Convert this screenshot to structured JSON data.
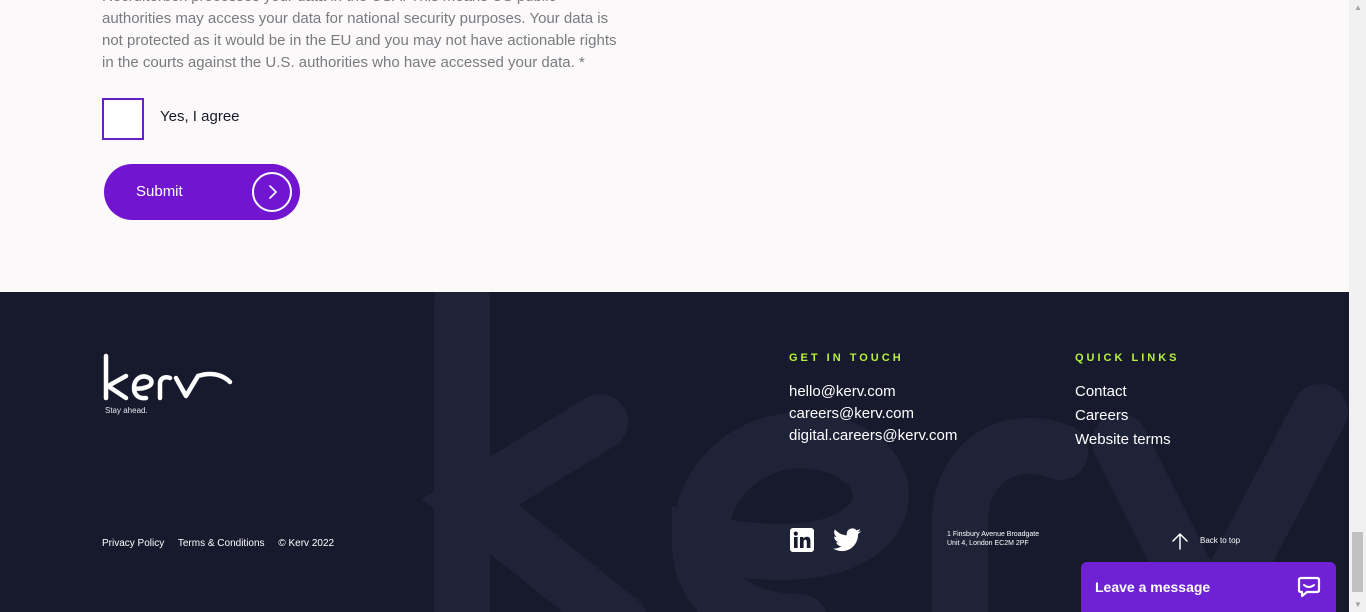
{
  "form": {
    "consent_text": "Recruiterbox processes your data in the USA. This means US public authorities may access your data for national security purposes. Your data is not protected as it would be in the EU and you may not have actionable rights in the courts against the U.S. authorities who have accessed your data. *",
    "agree_label": "Yes, I agree",
    "submit_label": "Submit"
  },
  "footer": {
    "tagline": "Stay ahead.",
    "get_in_touch": {
      "heading": "GET IN TOUCH",
      "emails": [
        "hello@kerv.com",
        "careers@kerv.com",
        "digital.careers@kerv.com"
      ]
    },
    "quick_links": {
      "heading": "QUICK LINKS",
      "items": [
        "Contact",
        "Careers",
        "Website terms"
      ]
    },
    "legal": {
      "privacy": "Privacy Policy",
      "terms": "Terms & Conditions",
      "copyright": "© Kerv 2022"
    },
    "address": [
      "1 Finsbury Avenue Broadgate",
      "Unit 4, London EC2M 2PF"
    ],
    "back_to_top": "Back to top",
    "social_icons": [
      "linkedin-icon",
      "twitter-icon"
    ]
  },
  "chat": {
    "label": "Leave a message",
    "icon": "chat-bubble-icon"
  },
  "colors": {
    "accent_purple": "#7215d1",
    "footer_bg": "#161a2c",
    "heading_green": "#b6f23a",
    "page_bg": "#fbf9f9"
  }
}
